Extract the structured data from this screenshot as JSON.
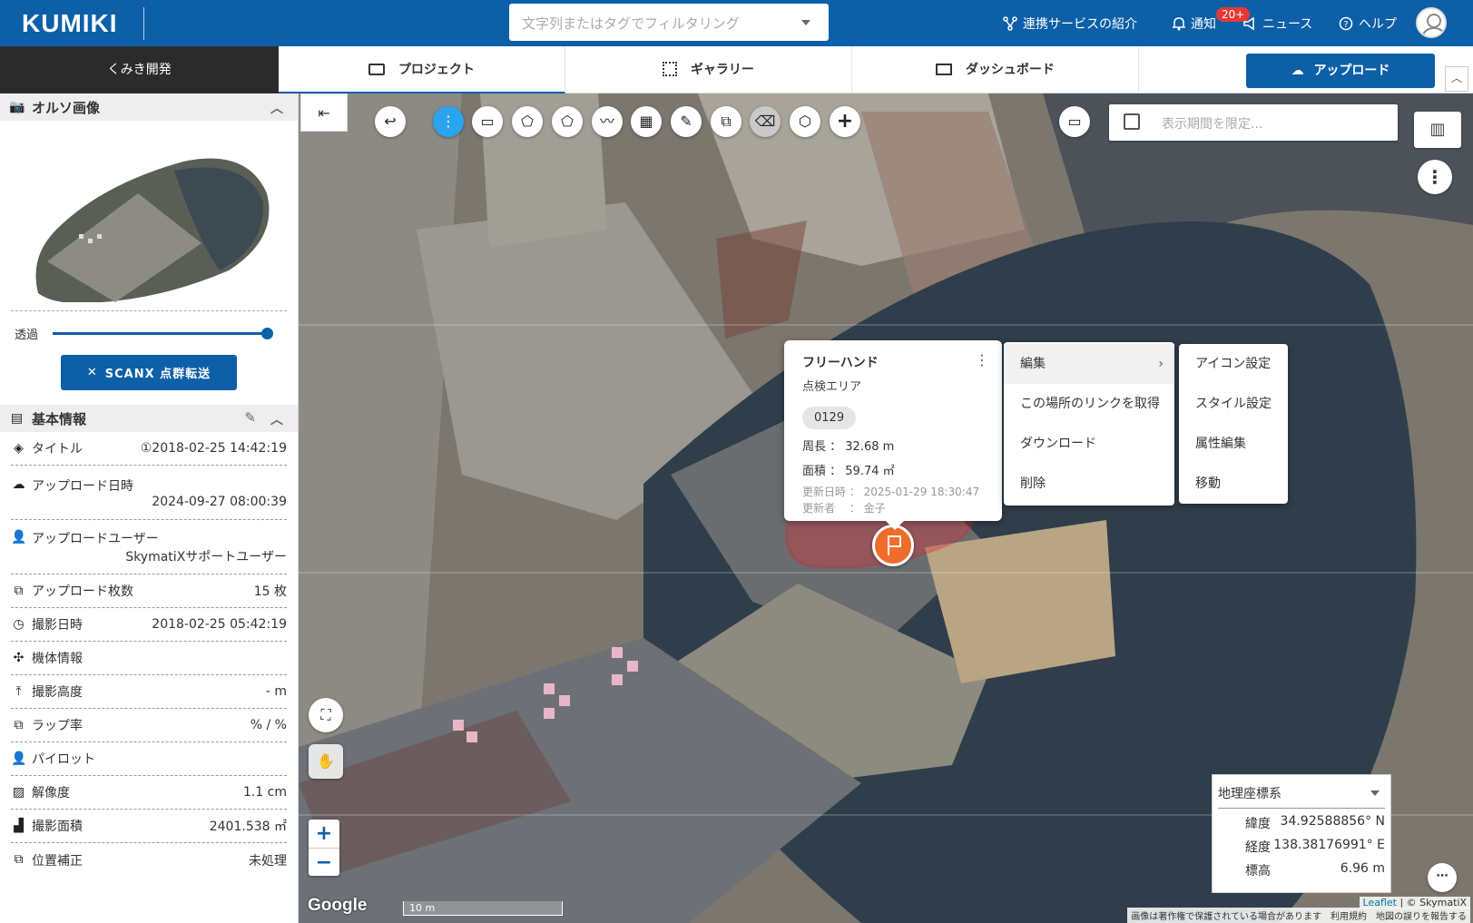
{
  "header": {
    "logo": "KUMIKI",
    "search_placeholder": "文字列またはタグでフィルタリング",
    "nav_services": "連携サービスの紹介",
    "nav_notify": "通知",
    "notify_badge": "20+",
    "nav_news": "ニュース",
    "nav_help": "ヘルプ"
  },
  "tabs": {
    "project_name": "くみき開発",
    "project": "プロジェクト",
    "gallery": "ギャラリー",
    "dashboard": "ダッシュボード",
    "upload": "アップロード"
  },
  "sidebar": {
    "ortho_title": "オルソ画像",
    "transparency_label": "透過",
    "transparency_value": 1.0,
    "scanx_label": "SCANX 点群転送",
    "basic_title": "基本情報",
    "rows": {
      "title_label": "タイトル",
      "title_value": "①2018-02-25 14:42:19",
      "upload_date_label": "アップロード日時",
      "upload_date_value": "2024-09-27 08:00:39",
      "upload_user_label": "アップロードユーザー",
      "upload_user_value": "SkymatiXサポートユーザー",
      "upload_count_label": "アップロード枚数",
      "upload_count_value": "15 枚",
      "shoot_date_label": "撮影日時",
      "shoot_date_value": "2018-02-25 05:42:19",
      "aircraft_label": "機体情報",
      "aircraft_value": "",
      "altitude_label": "撮影高度",
      "altitude_value": "- m",
      "overlap_label": "ラップ率",
      "overlap_value": "% / %",
      "pilot_label": "パイロット",
      "pilot_value": "",
      "resolution_label": "解像度",
      "resolution_value": "1.1 cm",
      "area_label": "撮影面積",
      "area_value": "2401.538 ㎡",
      "correction_label": "位置補正",
      "correction_value": "未処理"
    }
  },
  "map": {
    "date_placeholder": "表示期間を限定...",
    "popup": {
      "title": "フリーハンド",
      "subtitle": "点検エリア",
      "tag": "0129",
      "perimeter_label": "周長 ：",
      "perimeter_value": "32.68 m",
      "area_label": "面積 ：",
      "area_value": "59.74 ㎡",
      "updated_label": "更新日時 ：",
      "updated_value": "2025-01-29 18:30:47",
      "updater_label": "更新者 　：",
      "updater_value": "金子"
    },
    "menu": {
      "edit": "編集",
      "get_link": "この場所のリンクを取得",
      "download": "ダウンロード",
      "delete": "削除"
    },
    "submenu": {
      "icon_settings": "アイコン設定",
      "style_settings": "スタイル設定",
      "attr_edit": "属性編集",
      "move": "移動"
    },
    "coords": {
      "system": "地理座標系",
      "lat_label": "緯度",
      "lat_value": "34.92588856° N",
      "lng_label": "経度",
      "lng_value": "138.38176991° E",
      "alt_label": "標高",
      "alt_value": "6.96 m"
    },
    "google": "Google",
    "scale": "10 m",
    "attribution_leaflet": "Leaflet",
    "attribution_owner": "| © SkymatiX",
    "copyright_note": "画像は著作権で保護されている場合があります",
    "terms": "利用規約",
    "report": "地図の誤りを報告する"
  },
  "colors": {
    "brand": "#0d5fa8",
    "marker": "#ef6c2b",
    "active_tool": "#2aa4ee",
    "polygon_stroke": "#e11d2a"
  }
}
